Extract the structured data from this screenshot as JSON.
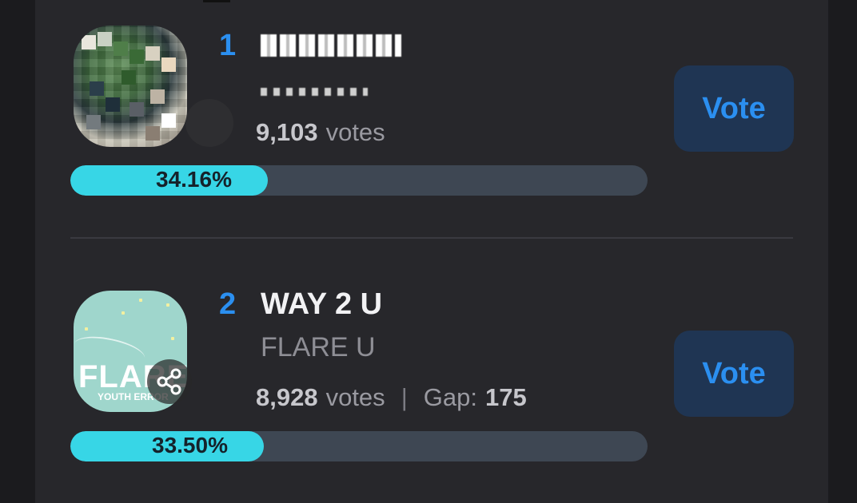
{
  "entries": [
    {
      "rank": "1",
      "title": "",
      "artist": "",
      "votes": "9,103",
      "votes_suffix": "votes",
      "percent_label": "34.16%",
      "percent_value": 34.16,
      "vote_label": "Vote"
    },
    {
      "rank": "2",
      "title": "WAY 2 U",
      "artist": "FLARE U",
      "votes": "8,928",
      "votes_suffix": "votes",
      "gap_label": "Gap:",
      "gap_value": "175",
      "separator": "|",
      "percent_label": "33.50%",
      "percent_value": 33.5,
      "vote_label": "Vote",
      "album_text": "FLARE",
      "album_subtext": "YOUTH ERROR"
    }
  ],
  "colors": {
    "accent": "#2b8ff0",
    "bar_fill": "#37d6e6",
    "bar_track": "#3e4753",
    "vote_button_bg": "#1f3553",
    "panel_bg": "#27272b"
  },
  "icons": {
    "share": "share-icon"
  }
}
